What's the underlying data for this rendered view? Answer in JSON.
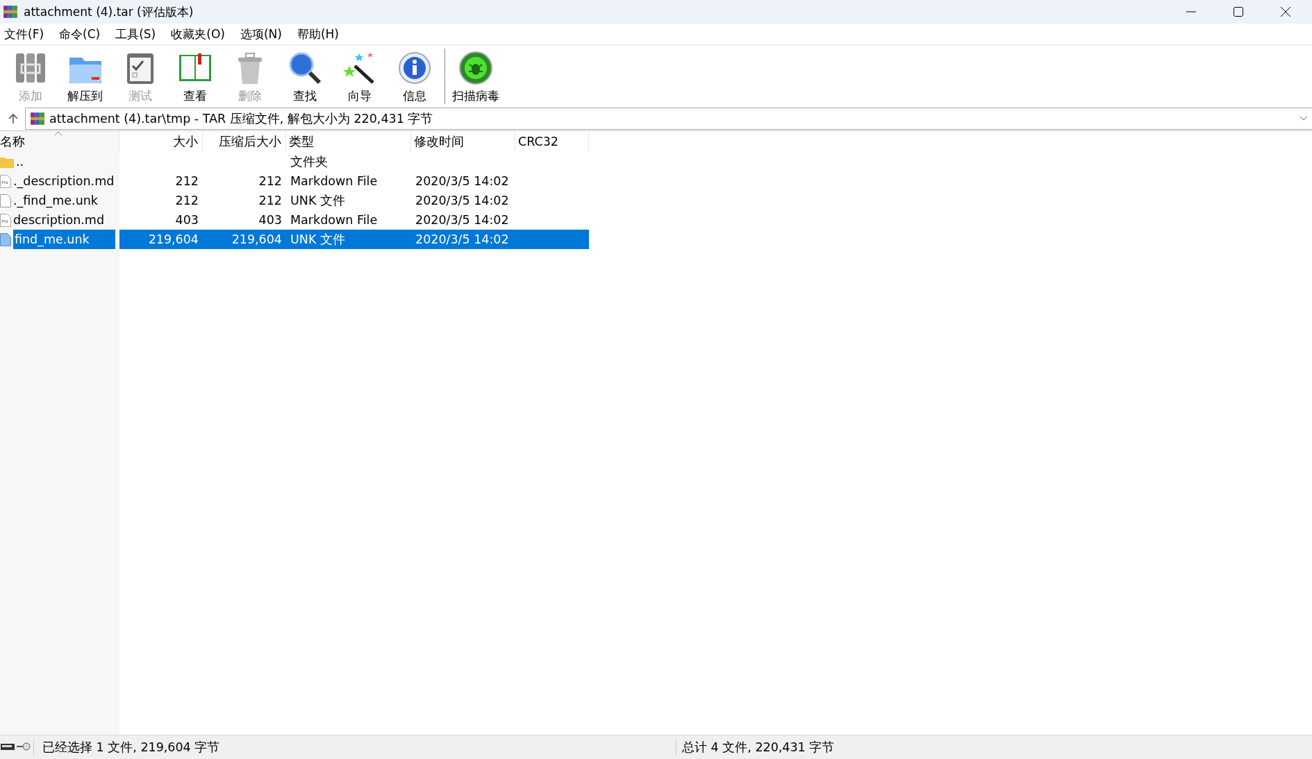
{
  "window": {
    "title": "attachment (4).tar (评估版本)"
  },
  "menu": [
    "文件(F)",
    "命令(C)",
    "工具(S)",
    "收藏夹(O)",
    "选项(N)",
    "帮助(H)"
  ],
  "toolbar": [
    {
      "kind": "add",
      "label": "添加",
      "disabled": true
    },
    {
      "kind": "extract",
      "label": "解压到",
      "disabled": false
    },
    {
      "kind": "test",
      "label": "测试",
      "disabled": true
    },
    {
      "kind": "view",
      "label": "查看",
      "disabled": false
    },
    {
      "kind": "delete",
      "label": "删除",
      "disabled": true
    },
    {
      "kind": "find",
      "label": "查找",
      "disabled": false
    },
    {
      "kind": "wizard",
      "label": "向导",
      "disabled": false
    },
    {
      "kind": "info",
      "label": "信息",
      "disabled": false
    },
    {
      "kind": "scan",
      "label": "扫描病毒",
      "disabled": false
    }
  ],
  "address": {
    "value": "attachment (4).tar\\tmp - TAR 压缩文件, 解包大小为 220,431 字节"
  },
  "table": {
    "columns": [
      {
        "label": "名称",
        "sorted": true
      },
      {
        "label": "大小",
        "sorted": false
      },
      {
        "label": "压缩后大小",
        "sorted": false
      },
      {
        "label": "类型",
        "sorted": false
      },
      {
        "label": "修改时间",
        "sorted": false
      },
      {
        "label": "CRC32",
        "sorted": false
      }
    ],
    "rows": [
      {
        "kind": "folder",
        "selected": false,
        "cells": [
          "..",
          "",
          "",
          "文件夹",
          "",
          ""
        ]
      },
      {
        "kind": "markdown",
        "selected": false,
        "cells": [
          "._description.md",
          "212",
          "212",
          "Markdown File",
          "2020/3/5 14:02",
          ""
        ]
      },
      {
        "kind": "file",
        "selected": false,
        "cells": [
          "._find_me.unk",
          "212",
          "212",
          "UNK 文件",
          "2020/3/5 14:02",
          ""
        ]
      },
      {
        "kind": "markdown",
        "selected": false,
        "cells": [
          "description.md",
          "403",
          "403",
          "Markdown File",
          "2020/3/5 14:02",
          ""
        ]
      },
      {
        "kind": "file",
        "selected": true,
        "cells": [
          "find_me.unk",
          "219,604",
          "219,604",
          "UNK 文件",
          "2020/3/5 14:02",
          ""
        ]
      }
    ]
  },
  "status_bar": {
    "left": "已经选择 1 文件, 219,604 字节",
    "right": "总计 4 文件, 220,431 字节"
  }
}
